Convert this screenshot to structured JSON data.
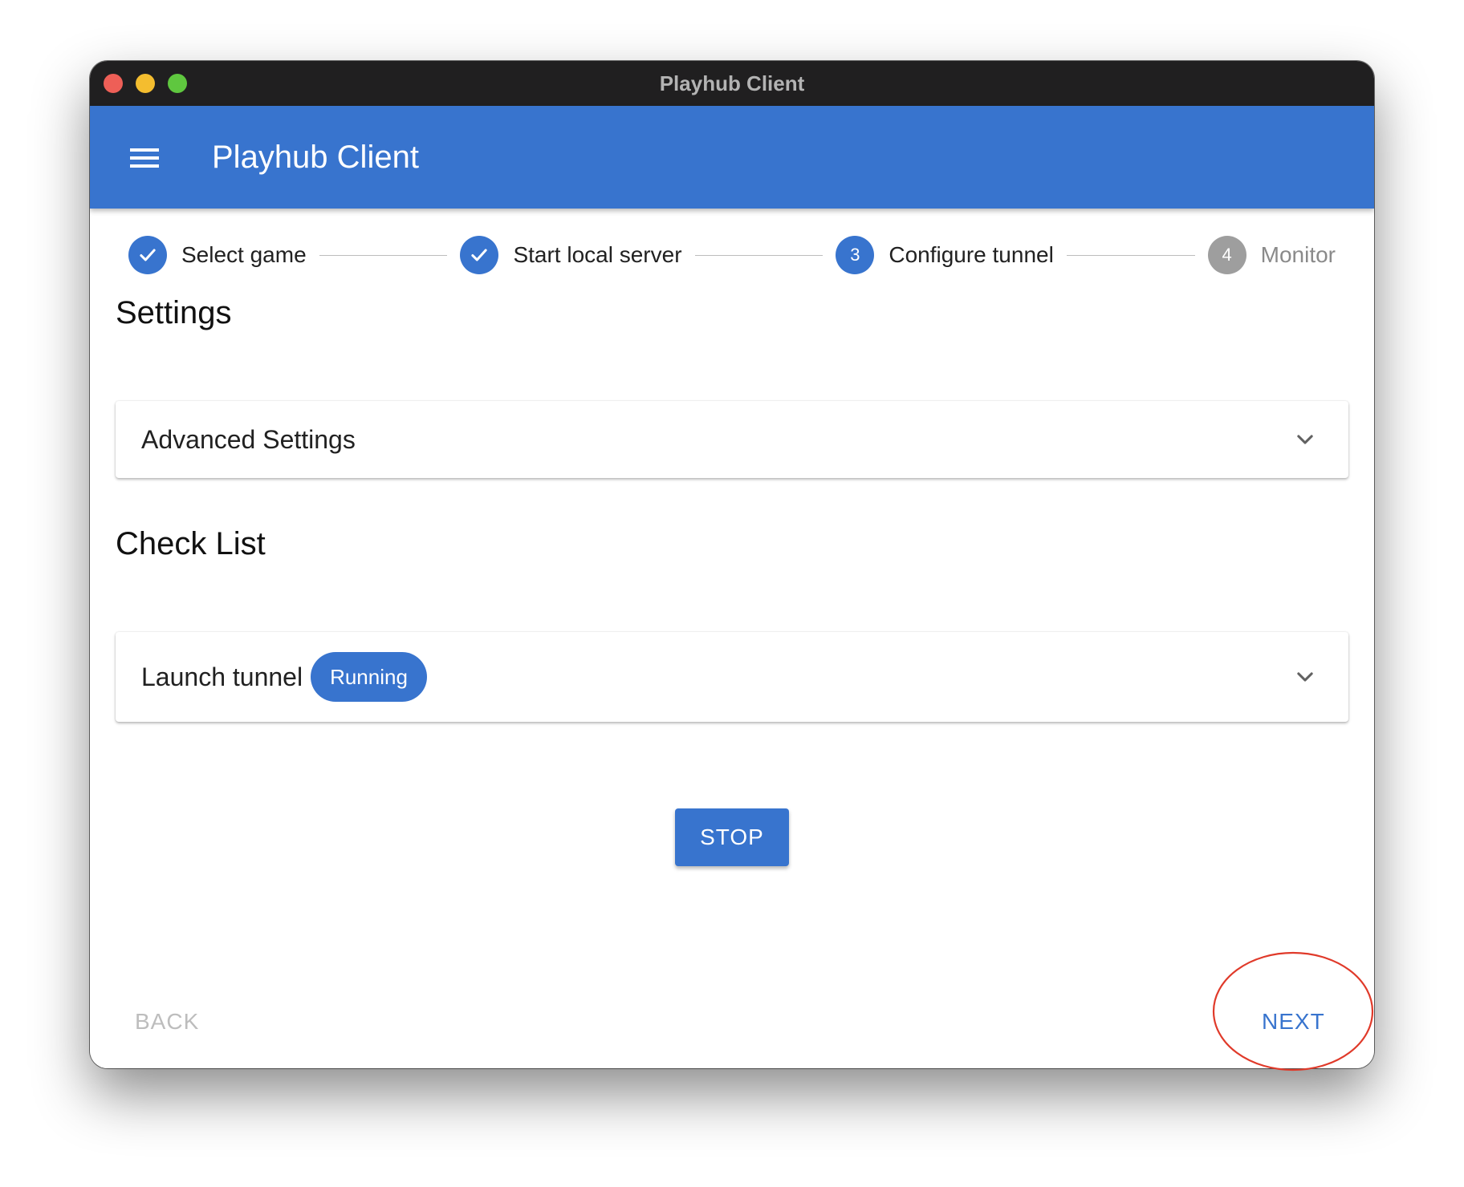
{
  "window": {
    "title": "Playhub Client"
  },
  "appbar": {
    "title": "Playhub Client",
    "menu_icon": "hamburger-menu-icon"
  },
  "stepper": {
    "steps": [
      {
        "label": "Select game",
        "state": "completed",
        "icon": "check-icon"
      },
      {
        "label": "Start local server",
        "state": "completed",
        "icon": "check-icon"
      },
      {
        "label": "Configure tunnel",
        "state": "active",
        "number": "3"
      },
      {
        "label": "Monitor",
        "state": "inactive",
        "number": "4"
      }
    ]
  },
  "settings": {
    "title": "Settings",
    "advanced": {
      "label": "Advanced Settings",
      "expanded": false
    }
  },
  "checklist": {
    "title": "Check List",
    "item": {
      "label": "Launch tunnel",
      "status": "Running",
      "expanded": false
    }
  },
  "actions": {
    "stop": "STOP",
    "back": "BACK",
    "next": "NEXT",
    "back_enabled": false
  },
  "colors": {
    "primary": "#3874ce",
    "titlebar": "#201f20",
    "inactive_step": "#9e9e9e",
    "disabled_text": "#bdbdbd",
    "annotation": "#e03a2a"
  }
}
